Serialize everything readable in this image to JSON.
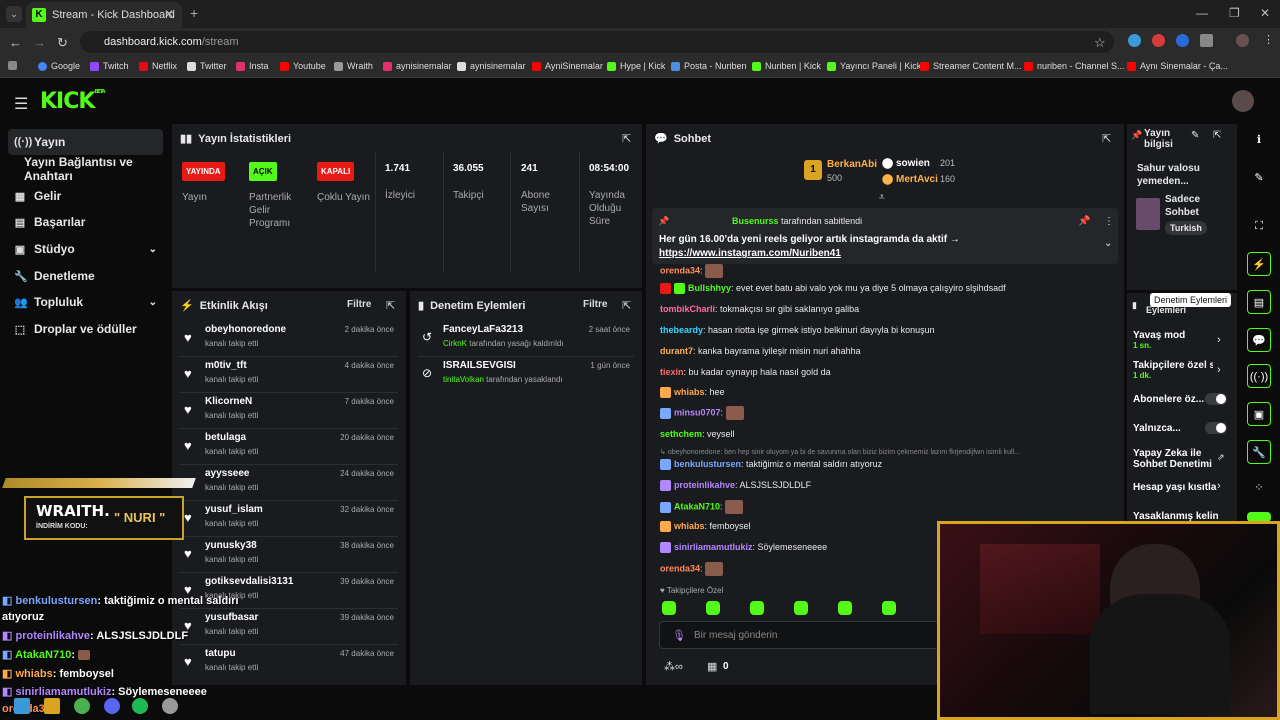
{
  "browser": {
    "tab_title": "Stream - Kick Dashboard",
    "url_host": "dashboard.kick.com",
    "url_path": "/stream",
    "bookmarks": [
      "Google",
      "Twitch",
      "Netflix",
      "Twitter",
      "Insta",
      "Youtube",
      "Wraith",
      "aynisinemalar",
      "aynisinemalar",
      "AyniSinemalar",
      "Hype | Kick",
      "Posta - Nuriben",
      "Nuriben | Kick",
      "Yayıncı Paneli | Kick",
      "Streamer Content M...",
      "nuriben - Channel S...",
      "Aynı Sinemalar - Ça..."
    ]
  },
  "brand": {
    "logo": "KICK",
    "beta": "BETA",
    "accent": "#53fc18"
  },
  "sidebar": {
    "items": [
      {
        "label": "Yayın",
        "icon": "stream-icon"
      },
      {
        "label": "Yayın Bağlantısı ve Anahtarı"
      },
      {
        "label": "Gelir",
        "icon": "revenue-icon"
      },
      {
        "label": "Başarılar",
        "icon": "achievements-icon"
      },
      {
        "label": "Stüdyo",
        "icon": "studio-icon"
      },
      {
        "label": "Denetleme",
        "icon": "moderation-icon"
      },
      {
        "label": "Topluluk",
        "icon": "community-icon"
      },
      {
        "label": "Droplar ve ödüller",
        "icon": "drops-icon"
      }
    ]
  },
  "stats": {
    "title": "Yayın İstatistikleri",
    "badges": [
      {
        "badge": "YAYINDA",
        "label": "Yayın"
      },
      {
        "badge": "AÇIK",
        "label": "Partnerlik Gelir Programı"
      },
      {
        "badge": "KAPALI",
        "label": "Çoklu Yayın"
      }
    ],
    "metrics": [
      {
        "value": "1.741",
        "label": "İzleyici"
      },
      {
        "value": "36.055",
        "label": "Takipçi"
      },
      {
        "value": "241",
        "label": "Abone Sayısı"
      },
      {
        "value": "08:54:00",
        "label": "Yayında Olduğu Süre"
      }
    ]
  },
  "activity": {
    "title": "Etkinlik Akışı",
    "filter": "Filtre",
    "events": [
      {
        "name": "obeyhonoredone",
        "action": "kanalı takip etti",
        "time": "2 dakika önce"
      },
      {
        "name": "m0tiv_tft",
        "action": "kanalı takip etti",
        "time": "4 dakika önce"
      },
      {
        "name": "KlicorneN",
        "action": "kanalı takip etti",
        "time": "7 dakika önce"
      },
      {
        "name": "betulaga",
        "action": "kanalı takip etti",
        "time": "20 dakika önce"
      },
      {
        "name": "ayysseee",
        "action": "kanalı takip etti",
        "time": "24 dakika önce"
      },
      {
        "name": "yusuf_islam",
        "action": "kanalı takip etti",
        "time": "32 dakika önce"
      },
      {
        "name": "yunusky38",
        "action": "kanalı takip etti",
        "time": "38 dakika önce"
      },
      {
        "name": "gotiksevdalisi3131",
        "action": "kanalı takip etti",
        "time": "39 dakika önce"
      },
      {
        "name": "yusufbasar",
        "action": "kanalı takip etti",
        "time": "39 dakika önce"
      },
      {
        "name": "tatupu",
        "action": "kanalı takip etti",
        "time": "47 dakika önce"
      }
    ]
  },
  "modlog": {
    "title": "Denetim Eylemleri",
    "filter": "Filtre",
    "items": [
      {
        "name": "FanceyLaFa3213",
        "mod": "CirknK",
        "action": "tarafından yasağı kaldırıldı",
        "time": "2 saat önce"
      },
      {
        "name": "ISRAILSEVGISI",
        "mod": "tinitaVolkan",
        "action": "tarafından yasaklandı",
        "time": "1 gün önce"
      }
    ]
  },
  "chat": {
    "title": "Sohbet",
    "top": [
      {
        "rank": "1",
        "name": "BerkanAbi",
        "amount": "500"
      },
      {
        "name": "sowien",
        "amount": "201"
      },
      {
        "name": "MertAvci",
        "amount": "160"
      }
    ],
    "pinned": {
      "by": "Busenurss",
      "by_suffix": "tarafından sabitlendi",
      "text": "Her gün 16.00'da yeni reels geliyor artık instagramda da aktif →",
      "link": "https://www.instagram.com/Nuriben41"
    },
    "messages": [
      {
        "user": "orenda34",
        "color": "#ff8c5a",
        "text": ""
      },
      {
        "user": "Bullshhyy",
        "color": "#53fc18",
        "text": "evet evet batu abi valo yok mu ya diye 5 olmaya çalışyiro slşihdsadf"
      },
      {
        "user": "tombikCharli",
        "color": "#ff6b9d",
        "text": "tokmakçısı sır gibi saklanıyo galiba"
      },
      {
        "user": "thebeardy",
        "color": "#3ad7ff",
        "text": "hasan riotta işe girmek istiyo belkinuri dayıyla bi konuşun"
      },
      {
        "user": "durant7",
        "color": "#ffb347",
        "text": "kanka bayrama iyileşir misin nuri ahahha"
      },
      {
        "user": "tiexin",
        "color": "#ff6b6b",
        "text": "bu kadar oynayıp hala nasıl gold da"
      },
      {
        "user": "whiabs",
        "color": "#ffa94d",
        "text": "hee"
      },
      {
        "user": "minsu0707",
        "color": "#b388ff",
        "text": ""
      },
      {
        "user": "sethchem",
        "color": "#53fc18",
        "text": "veysell"
      },
      {
        "user": "benkulustursen",
        "color": "#7aa7ff",
        "text": "taktiğimiz o mental saldırı atıyoruz"
      },
      {
        "user": "proteinlikahve",
        "color": "#b388ff",
        "text": "ALSJSLSJDLDLF"
      },
      {
        "user": "AtakaN710",
        "color": "#53fc18",
        "text": ""
      },
      {
        "user": "whiabs",
        "color": "#ffa94d",
        "text": "femboysel"
      },
      {
        "user": "sinirliamamutlukiz",
        "color": "#b388ff",
        "text": "Söylemeseneeee"
      },
      {
        "user": "orenda34",
        "color": "#ff8c5a",
        "text": ""
      }
    ],
    "reply_preview": "obeyhonoredone: ben hep sinir oluyom ya bi de savunma olan biziz bizim çekmemiz lazım fkrjendijfwn isimli kull...",
    "followers_only": "Takipçilere Özel",
    "input_placeholder": "Bir mesaj gönderin",
    "counter": "0"
  },
  "streaminfo": {
    "title": "Yayın bilgisi",
    "stream_title": "Sahur valosu yemeden...",
    "category": "Sadece Sohbet",
    "language": "Turkish"
  },
  "modsettings": {
    "tooltip": "Denetim Eylemleri",
    "header": "Eylemleri",
    "items": [
      {
        "label": "Yavaş mod",
        "sub": "1 sn."
      },
      {
        "label": "Takipçilere özel s",
        "sub": "1 dk."
      },
      {
        "label": "Abonelere öz..."
      },
      {
        "label": "Yalnızca..."
      },
      {
        "label": "Yapay Zeka ile Sohbet Denetimi"
      },
      {
        "label": "Hesap yaşı kısıtla"
      },
      {
        "label": "Yasaklanmış kelin"
      }
    ]
  },
  "overlay": {
    "sponsor_brand": "WRAITH.",
    "sponsor_code_label": "İNDİRİM KODU:",
    "sponsor_code": "\" NURI \"",
    "chat": [
      {
        "user": "benkulustursen",
        "text": ": taktiğimiz o mental saldırı"
      },
      {
        "user": "",
        "text": "atıyoruz"
      },
      {
        "user": "proteinlikahve",
        "text": ": ALSJSLSJDLDLF"
      },
      {
        "user": "AtakaN710",
        "text": ":"
      },
      {
        "user": "whiabs",
        "text": ": femboysel"
      },
      {
        "user": "sinirliamamutlukiz",
        "text": ": Söylemeseneeee"
      },
      {
        "user": "orenda34",
        "text": ":"
      }
    ]
  }
}
